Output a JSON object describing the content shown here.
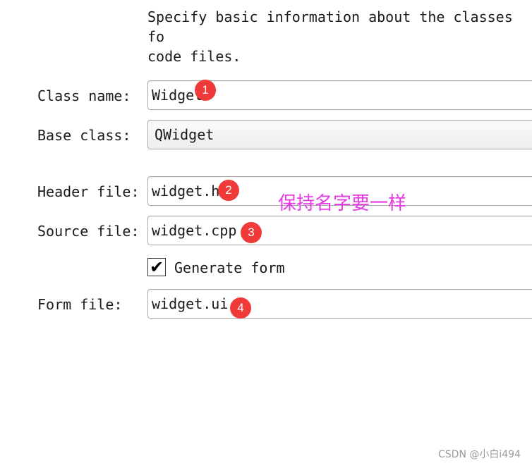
{
  "description": "Specify basic information about the classes fo\ncode files.",
  "fields": {
    "class_name": {
      "label": "Class name:",
      "value": "Widget"
    },
    "base_class": {
      "label": "Base class:",
      "value": "QWidget"
    },
    "header_file": {
      "label": "Header file:",
      "value": "widget.h"
    },
    "source_file": {
      "label": "Source file:",
      "value": "widget.cpp"
    },
    "form_file": {
      "label": "Form file:",
      "value": "widget.ui"
    }
  },
  "generate_form": {
    "label": "Generate form",
    "checked": true,
    "mark": "✔"
  },
  "badges": [
    "1",
    "2",
    "3",
    "4"
  ],
  "annotation": "保持名字要一样",
  "watermark": "CSDN @小白i494",
  "colors": {
    "badge": "#f03a3a",
    "annotation": "#e639e6"
  }
}
